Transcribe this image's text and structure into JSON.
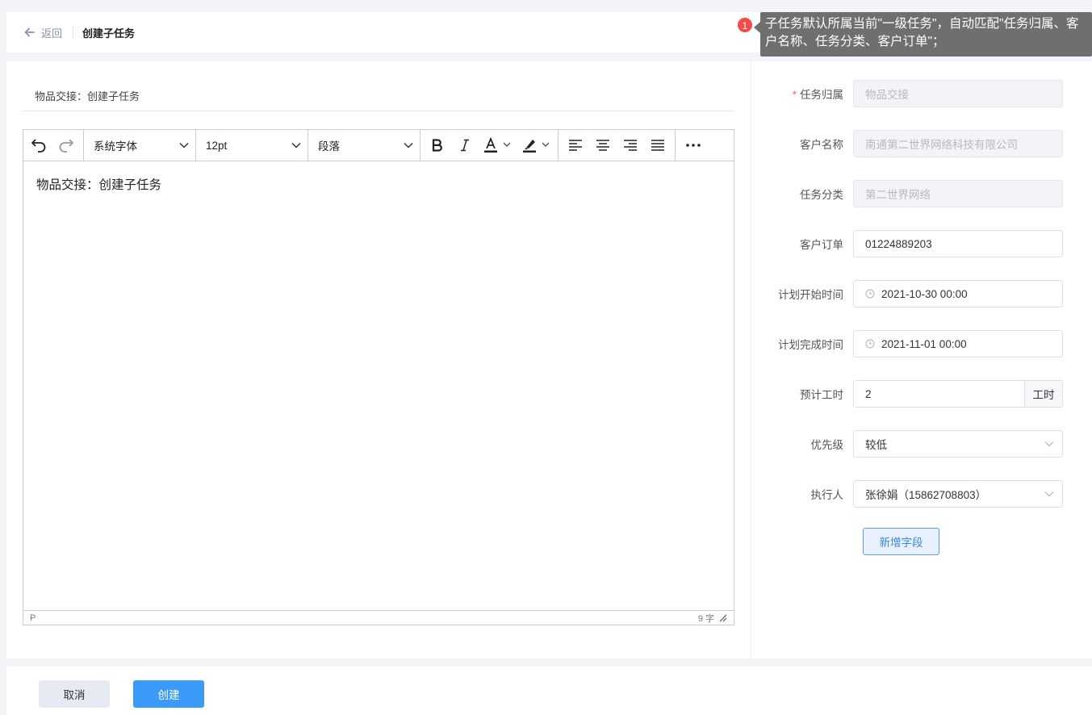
{
  "header": {
    "back_label": "返回",
    "title": "创建子任务"
  },
  "tooltip": {
    "number": "1",
    "text": "子任务默认所属当前\"一级任务\"，自动匹配\"任务归属、客户名称、任务分类、客户订单\"；"
  },
  "subject": {
    "value": "物品交接：创建子任务"
  },
  "editor": {
    "font_family": "系统字体",
    "font_size": "12pt",
    "block_format": "段落",
    "content": "物品交接：创建子任务",
    "status_path": "P",
    "word_count": "9 字"
  },
  "form": {
    "task_owner": {
      "label": "任务归属",
      "value": "物品交接"
    },
    "customer_name": {
      "label": "客户名称",
      "value": "南通第二世界网络科技有限公司"
    },
    "task_category": {
      "label": "任务分类",
      "value": "第二世界网络"
    },
    "customer_order": {
      "label": "客户订单",
      "value": "01224889203"
    },
    "plan_start": {
      "label": "计划开始时间",
      "value": "2021-10-30 00:00"
    },
    "plan_end": {
      "label": "计划完成时间",
      "value": "2021-11-01 00:00"
    },
    "est_hours": {
      "label": "预计工时",
      "value": "2",
      "unit": "工时"
    },
    "priority": {
      "label": "优先级",
      "value": "较低"
    },
    "assignee": {
      "label": "执行人",
      "value": "张徐娟（15862708803）"
    },
    "add_field_label": "新增字段"
  },
  "footer": {
    "cancel_label": "取消",
    "create_label": "创建"
  },
  "colors": {
    "primary": "#3a9af7",
    "required": "#f56c6c",
    "badge": "#f44a4a"
  }
}
